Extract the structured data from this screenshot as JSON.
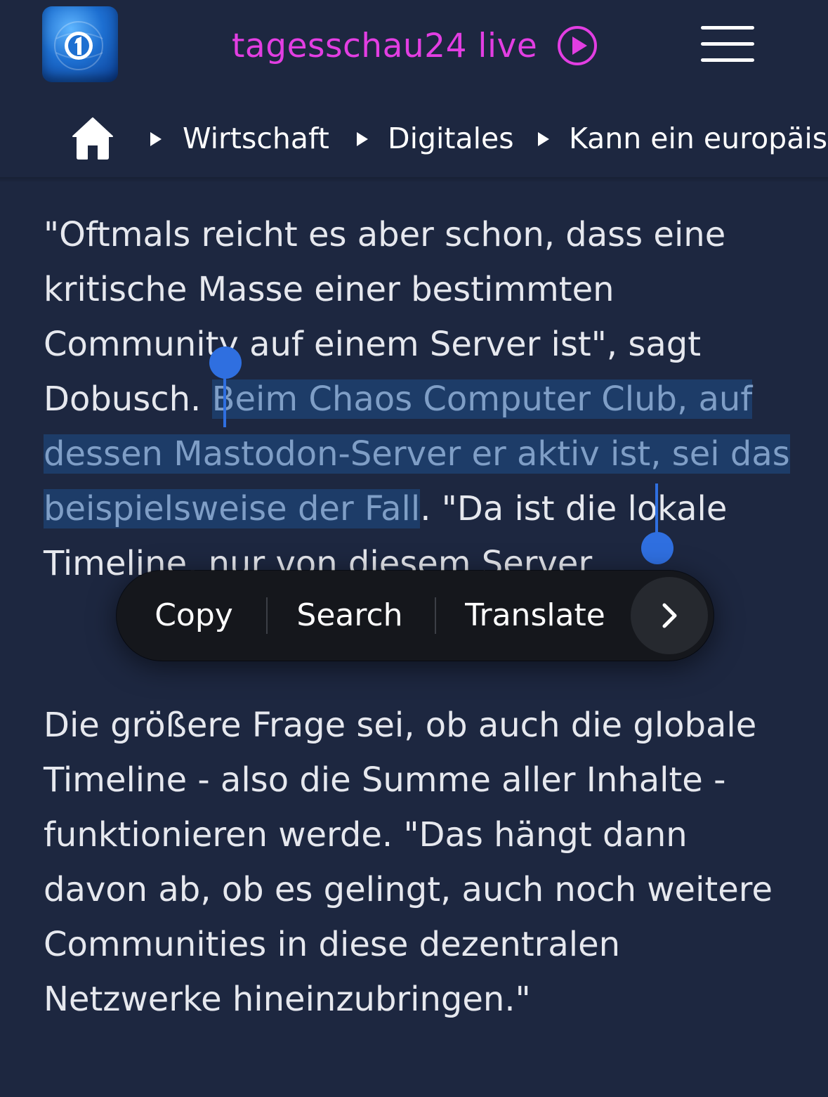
{
  "header": {
    "live_label": "tagesschau24 live"
  },
  "breadcrumb": {
    "items": [
      "Wirtschaft",
      "Digitales",
      "Kann ein europäisch"
    ]
  },
  "article": {
    "para1_before": "\"Oftmals reicht es aber schon, dass eine kritische Masse einer bestimmten Community auf einem Server ist\", sagt Dobusch. ",
    "para1_selected": "Beim Chaos Computer Club, auf dessen Mastodon-Server er aktiv ist, sei das beispielsweise der Fall",
    "para1_after": ". \"Da ist die lokale Timeline, nur von diesem Server",
    "para2": "Die größere Frage sei, ob auch die globale Timeline - also die Summe aller Inhalte - funktionieren werde. \"Das hängt dann davon ab, ob es gelingt, auch noch weitere Communities in diese dezentralen Netzwerke hineinzubringen.\""
  },
  "context_menu": {
    "copy": "Copy",
    "search": "Search",
    "translate": "Translate"
  },
  "colors": {
    "background": "#1d2740",
    "live_accent": "#e23ee2",
    "selection": "#1d3c68",
    "handle": "#2f6fe0"
  }
}
